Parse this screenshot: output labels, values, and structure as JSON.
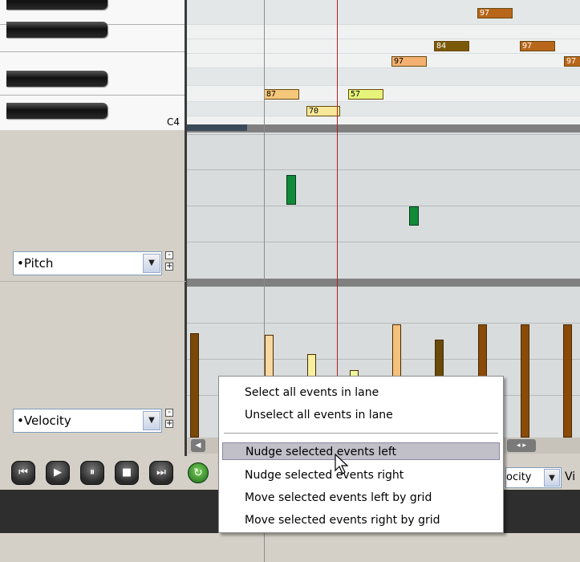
{
  "piano": {
    "c4_label": "C4"
  },
  "notes": [
    {
      "label": "97",
      "color": "#b8661a",
      "text_color": "#fff"
    },
    {
      "label": "84",
      "color": "#7a5a08",
      "text_color": "#fff"
    },
    {
      "label": "97",
      "color": "#b8661a",
      "text_color": "#fff"
    },
    {
      "label": "97",
      "color": "#f3b070",
      "text_color": "#000"
    },
    {
      "label": "97",
      "color": "#b8661a",
      "text_color": "#fff"
    },
    {
      "label": "87",
      "color": "#f5c77a",
      "text_color": "#000"
    },
    {
      "label": "57",
      "color": "#e6f57a",
      "text_color": "#000"
    },
    {
      "label": "70",
      "color": "#f7e89a",
      "text_color": "#000"
    }
  ],
  "lanes": {
    "pitch": {
      "label": "•Pitch",
      "minus": "-",
      "plus": "+"
    },
    "velocity": {
      "label": "•Velocity",
      "minus": "-",
      "plus": "+"
    }
  },
  "transport": {
    "buttons": [
      {
        "name": "rewind-to-start-button",
        "glyph": "⏮"
      },
      {
        "name": "play-button",
        "glyph": "▶"
      },
      {
        "name": "pause-button",
        "glyph": "⏸"
      },
      {
        "name": "stop-button",
        "glyph": "■"
      },
      {
        "name": "forward-to-end-button",
        "glyph": "⏭"
      }
    ],
    "loop_glyph": "↻",
    "lane_combo": "ocity",
    "vi_label": "Vi"
  },
  "context_menu": {
    "items": [
      {
        "label": "Select all events in lane"
      },
      {
        "label": "Unselect all events in lane"
      },
      {
        "label": "Nudge selected events left",
        "highlighted": true
      },
      {
        "label": "Nudge selected events right"
      },
      {
        "label": "Move selected events left by grid"
      },
      {
        "label": "Move selected events right by grid"
      }
    ]
  },
  "colors": {
    "playhead": "#b02020",
    "pitch_bar": "#118a3a"
  }
}
